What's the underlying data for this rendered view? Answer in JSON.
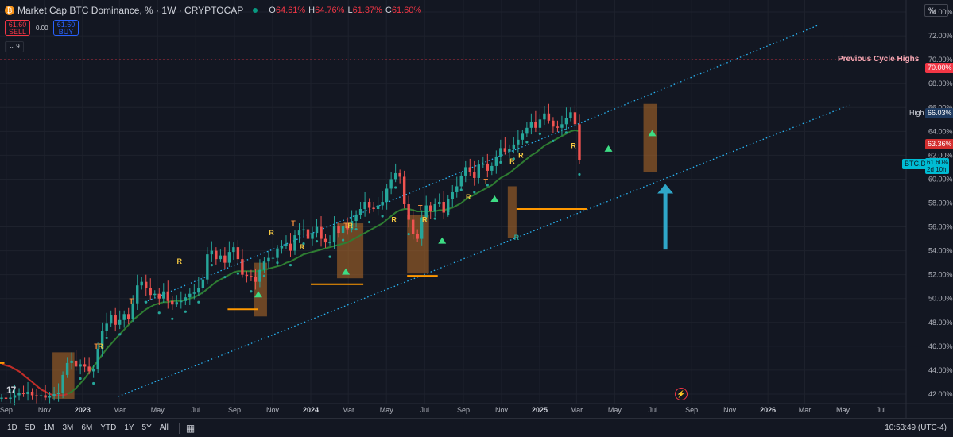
{
  "header": {
    "title": "Market Cap BTC Dominance, % · 1W · CRYPTOCAP",
    "ohlc": [
      {
        "k": "O",
        "v": "64.61%"
      },
      {
        "k": "H",
        "v": "64.76%"
      },
      {
        "k": "L",
        "v": "61.37%"
      },
      {
        "k": "C",
        "v": "61.60%"
      }
    ],
    "sell_price": "61.60",
    "sell_label": "SELL",
    "buy_price": "61.60",
    "buy_label": "BUY",
    "spread": "0.00",
    "indicators_count": "9",
    "scale_button": "%"
  },
  "annotation": {
    "previous_cycle": "Previous Cycle Highs"
  },
  "price_tags": {
    "level_70": "70.00%",
    "high_label": "High",
    "high_value": "66.03%",
    "current_red": "63.36%",
    "symbol": "BTC.D",
    "last": "61.60%",
    "countdown": "2d 10h"
  },
  "bottom_bar": {
    "ranges": [
      "1D",
      "5D",
      "1M",
      "3M",
      "6M",
      "YTD",
      "1Y",
      "5Y",
      "All"
    ],
    "clock": "10:53:49 (UTC-4)"
  },
  "colors": {
    "background": "#131722",
    "up": "#26a69a",
    "down": "#ef5350",
    "channel": "#29b6f6",
    "ema": "#2e7d32",
    "signal": "#f5c842",
    "fvg": "#b86e28",
    "arrow": "#2fa7c9",
    "previous_high": "#f23645"
  },
  "chart_data": {
    "type": "candlestick",
    "title": "Market Cap BTC Dominance, % · 1W · CRYPTOCAP",
    "y_axis": {
      "ticks": [
        "42.00%",
        "44.00%",
        "46.00%",
        "48.00%",
        "50.00%",
        "52.00%",
        "54.00%",
        "56.00%",
        "58.00%",
        "60.00%",
        "62.00%",
        "64.00%",
        "66.00%",
        "68.00%",
        "70.00%",
        "72.00%",
        "74.00%"
      ],
      "range": [
        41.2,
        75
      ]
    },
    "x_axis": {
      "ticks": [
        "Sep",
        "Nov",
        "2023",
        "Mar",
        "May",
        "Jul",
        "Sep",
        "Nov",
        "2024",
        "Mar",
        "May",
        "Jul",
        "Sep",
        "Nov",
        "2025",
        "Mar",
        "May",
        "Jul",
        "Sep",
        "Nov",
        "2026",
        "Mar",
        "May",
        "Jul"
      ],
      "start": "2022-08-22",
      "end": "2026-08-10"
    },
    "series": [
      {
        "name": "BTC.D",
        "weekly_close": [
          41.7,
          41.6,
          41.7,
          41.9,
          42.1,
          42.0,
          42.2,
          41.9,
          41.8,
          41.9,
          41.7,
          41.8,
          42.0,
          42.1,
          43.6,
          44.6,
          44.8,
          44.3,
          44.5,
          44.3,
          43.9,
          44.1,
          45.8,
          47.3,
          47.9,
          48.6,
          47.8,
          48.2,
          48.7,
          48.3,
          49.6,
          51.1,
          51.4,
          50.9,
          50.3,
          50.4,
          50.0,
          50.6,
          49.8,
          49.5,
          49.7,
          49.8,
          50.1,
          50.4,
          50.5,
          50.9,
          51.6,
          53.7,
          54.0,
          53.3,
          53.6,
          53.0,
          53.9,
          54.3,
          53.3,
          52.0,
          51.9,
          51.8,
          51.4,
          52.4,
          53.1,
          53.4,
          53.4,
          54.2,
          54.4,
          54.6,
          54.0,
          55.3,
          55.7,
          55.8,
          55.0,
          55.5,
          56.0,
          55.0,
          54.7,
          54.7,
          56.1,
          55.5,
          56.1,
          55.8,
          56.5,
          57.0,
          57.5,
          58.1,
          57.6,
          57.5,
          57.8,
          58.1,
          59.2,
          60.0,
          60.5,
          60.2,
          57.9,
          56.6,
          55.4,
          55.0,
          56.8,
          57.8,
          57.3,
          57.9,
          58.1,
          57.2,
          58.3,
          58.9,
          59.4,
          60.3,
          61.0,
          60.6,
          60.1,
          61.2,
          61.3,
          60.7,
          61.1,
          61.9,
          62.6,
          62.3,
          62.5,
          62.9,
          63.3,
          63.8,
          64.3,
          64.8,
          64.3,
          65.0,
          65.5,
          64.9,
          64.4,
          64.3,
          64.6,
          65.1,
          65.6,
          64.6,
          61.6
        ],
        "unit": "%"
      }
    ],
    "ema": [
      44.5,
      44.4,
      44.3,
      44.1,
      43.9,
      43.6,
      43.3,
      43.0,
      42.7,
      42.4,
      42.2,
      42.0,
      41.9,
      41.9,
      41.9,
      42.0,
      42.2,
      42.5,
      42.9,
      43.3,
      43.8,
      44.3,
      44.8,
      45.3,
      45.8,
      46.2,
      46.6,
      47.0,
      47.4,
      47.8,
      48.2,
      48.5,
      48.8,
      49.1,
      49.3,
      49.5,
      49.6,
      49.7,
      49.7,
      49.8,
      49.8,
      49.8,
      49.9,
      50.0,
      50.1,
      50.3,
      50.5,
      50.8,
      51.1,
      51.4,
      51.6,
      51.8,
      52.0,
      52.2,
      52.3,
      52.3,
      52.3,
      52.3,
      52.3,
      52.3,
      52.4,
      52.5,
      52.6,
      52.7,
      52.8,
      53.0,
      53.1,
      53.3,
      53.5,
      53.7,
      53.8,
      53.9,
      54.0,
      54.1,
      54.2,
      54.3,
      54.4,
      54.5,
      54.6,
      54.7,
      54.9,
      55.1,
      55.3,
      55.5,
      55.7,
      55.9,
      56.1,
      56.3,
      56.6,
      56.9,
      57.2,
      57.4,
      57.5,
      57.5,
      57.4,
      57.3,
      57.3,
      57.3,
      57.3,
      57.3,
      57.4,
      57.4,
      57.5,
      57.6,
      57.8,
      58.0,
      58.3,
      58.5,
      58.7,
      58.9,
      59.1,
      59.3,
      59.5,
      59.8,
      60.1,
      60.3,
      60.5,
      60.8,
      61.1,
      61.4,
      61.7,
      62.0,
      62.2,
      62.5,
      62.8,
      63.0,
      63.2,
      63.4,
      63.6,
      63.8,
      64.0,
      64.1,
      64.0
    ],
    "channel": {
      "upper": [
        [
          "2023-04-10",
          49.7
        ],
        [
          "2025-07-21",
          70.0
        ],
        [
          "2026-03-23",
          72.9
        ]
      ],
      "lower": [
        [
          "2023-02-27",
          41.8
        ],
        [
          "2025-11-24",
          60.4
        ],
        [
          "2026-05-11",
          66.2
        ]
      ]
    },
    "previous_cycle_high": 70.0,
    "signals": [
      {
        "t": "T",
        "date": "2023-01-23",
        "price": 45.8
      },
      {
        "t": "R",
        "date": "2023-01-30",
        "price": 45.8
      },
      {
        "t": "T",
        "date": "2023-03-20",
        "price": 49.6
      },
      {
        "t": "R",
        "date": "2023-06-05",
        "price": 52.9
      },
      {
        "t": "R",
        "date": "2023-10-30",
        "price": 55.3
      },
      {
        "t": "T",
        "date": "2023-12-04",
        "price": 56.1
      },
      {
        "t": "R",
        "date": "2023-12-18",
        "price": 54.1
      },
      {
        "t": "T",
        "date": "2024-02-26",
        "price": 55.9
      },
      {
        "t": "R",
        "date": "2024-03-04",
        "price": 55.9
      },
      {
        "t": "R",
        "date": "2024-05-13",
        "price": 56.4
      },
      {
        "t": "T",
        "date": "2024-06-24",
        "price": 57.4
      },
      {
        "t": "R",
        "date": "2024-07-01",
        "price": 56.4
      },
      {
        "t": "R",
        "date": "2024-09-09",
        "price": 58.3
      },
      {
        "t": "T",
        "date": "2024-10-07",
        "price": 59.6
      },
      {
        "t": "R",
        "date": "2024-11-18",
        "price": 61.3
      },
      {
        "t": "R",
        "date": "2024-12-02",
        "price": 61.8
      },
      {
        "t": "R",
        "date": "2024-11-25",
        "price": 54.9
      },
      {
        "t": "R",
        "date": "2025-02-24",
        "price": 62.6
      }
    ],
    "buy_triangles": [
      {
        "date": "2023-10-09",
        "price": 50.1
      },
      {
        "date": "2024-02-26",
        "price": 52.0
      },
      {
        "date": "2024-07-29",
        "price": 54.6
      },
      {
        "date": "2024-10-21",
        "price": 58.1
      },
      {
        "date": "2025-04-21",
        "price": 62.3
      },
      {
        "date": "2025-06-30",
        "price": 63.6
      }
    ],
    "zones": [
      {
        "from": "2022-11-14",
        "to": "2022-12-19",
        "top": 45.5,
        "bottom": 41.6
      },
      {
        "from": "2023-10-02",
        "to": "2023-10-23",
        "top": 53.0,
        "bottom": 48.5
      },
      {
        "from": "2024-02-12",
        "to": "2024-03-25",
        "top": 56.3,
        "bottom": 51.7
      },
      {
        "from": "2024-06-03",
        "to": "2024-07-08",
        "top": 57.0,
        "bottom": 52.1
      },
      {
        "from": "2024-11-11",
        "to": "2024-11-25",
        "top": 59.4,
        "bottom": 55.1
      },
      {
        "from": "2025-06-16",
        "to": "2025-07-07",
        "top": 66.3,
        "bottom": 60.6
      }
    ],
    "support_lines": [
      {
        "from": "2023-08-21",
        "to": "2023-10-09",
        "price": 49.1
      },
      {
        "from": "2024-01-01",
        "to": "2024-03-25",
        "price": 51.2
      },
      {
        "from": "2024-06-03",
        "to": "2024-07-22",
        "price": 51.9
      },
      {
        "from": "2024-11-25",
        "to": "2025-03-17",
        "price": 57.5
      },
      {
        "from": "2022-08-22",
        "to": "2022-08-29",
        "price": 44.6
      }
    ],
    "projection_arrow": {
      "date": "2025-07-21",
      "from": 54.1,
      "to": 59.6
    }
  }
}
